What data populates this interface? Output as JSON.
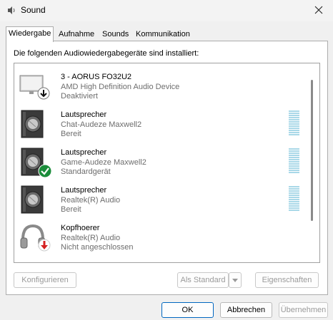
{
  "window": {
    "title": "Sound"
  },
  "tabs": [
    {
      "label": "Wiedergabe",
      "active": true
    },
    {
      "label": "Aufnahme",
      "active": false
    },
    {
      "label": "Sounds",
      "active": false
    },
    {
      "label": "Kommunikation",
      "active": false
    }
  ],
  "intro": "Die folgenden Audiowiedergabegeräte sind installiert:",
  "devices": [
    {
      "name": "3 - AORUS FO32U2",
      "driver": "AMD High Definition Audio Device",
      "status": "Deaktiviert",
      "icon": "monitor-icon",
      "badge": "down-arrow-badge"
    },
    {
      "name": "Lautsprecher",
      "driver": "Chat-Audeze Maxwell2",
      "status": "Bereit",
      "icon": "speaker-icon",
      "badge": ""
    },
    {
      "name": "Lautsprecher",
      "driver": "Game-Audeze Maxwell2",
      "status": "Standardgerät",
      "icon": "speaker-icon",
      "badge": "default-check-badge"
    },
    {
      "name": "Lautsprecher",
      "driver": "Realtek(R) Audio",
      "status": "Bereit",
      "icon": "speaker-icon",
      "badge": ""
    },
    {
      "name": "Kopfhoerer",
      "driver": "Realtek(R) Audio",
      "status": "Nicht angeschlossen",
      "icon": "headphones-icon",
      "badge": "unplugged-badge"
    }
  ],
  "buttons": {
    "configure": "Konfigurieren",
    "set_default": "Als Standard",
    "properties": "Eigenschaften",
    "ok": "OK",
    "cancel": "Abbrechen",
    "apply": "Übernehmen"
  },
  "colors": {
    "accent": "#0067c0",
    "check": "#1a8c3a",
    "unplugged": "#d42020",
    "meter": "#a9d8e8"
  }
}
